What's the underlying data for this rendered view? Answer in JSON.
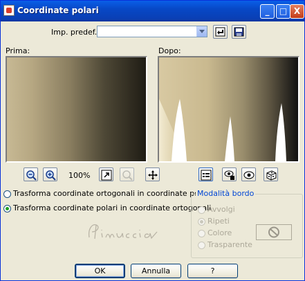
{
  "window": {
    "title": "Coordinate polari",
    "min_label": "_",
    "max_label": "□",
    "close_label": "X"
  },
  "preset": {
    "label": "Imp. predef.:",
    "value": ""
  },
  "panels": {
    "before_label": "Prima:",
    "after_label": "Dopo:"
  },
  "zoom": {
    "level": "100%"
  },
  "options": {
    "rect_to_polar": "Trasforma coordinate ortogonali in coordinate polari",
    "polar_to_rect": "Trasforma coordinate polari in coordinate ortogonali",
    "selected": "polar_to_rect"
  },
  "edge_mode": {
    "title": "Modalità bordo",
    "wrap": "Avvolgi",
    "repeat": "Ripeti",
    "color": "Colore",
    "transparent": "Trasparente",
    "selected": "repeat"
  },
  "buttons": {
    "ok": "OK",
    "cancel": "Annulla",
    "help": "?"
  },
  "watermark": "Pinuccia",
  "icons": [
    "reset-icon",
    "save-icon",
    "zoom-out-icon",
    "zoom-in-icon",
    "fit-window-icon",
    "zoom-disabled-icon",
    "move-icon",
    "preview-toggle-icon",
    "auto-proof-icon",
    "proof-icon",
    "randomize-icon",
    "no-color-icon"
  ]
}
